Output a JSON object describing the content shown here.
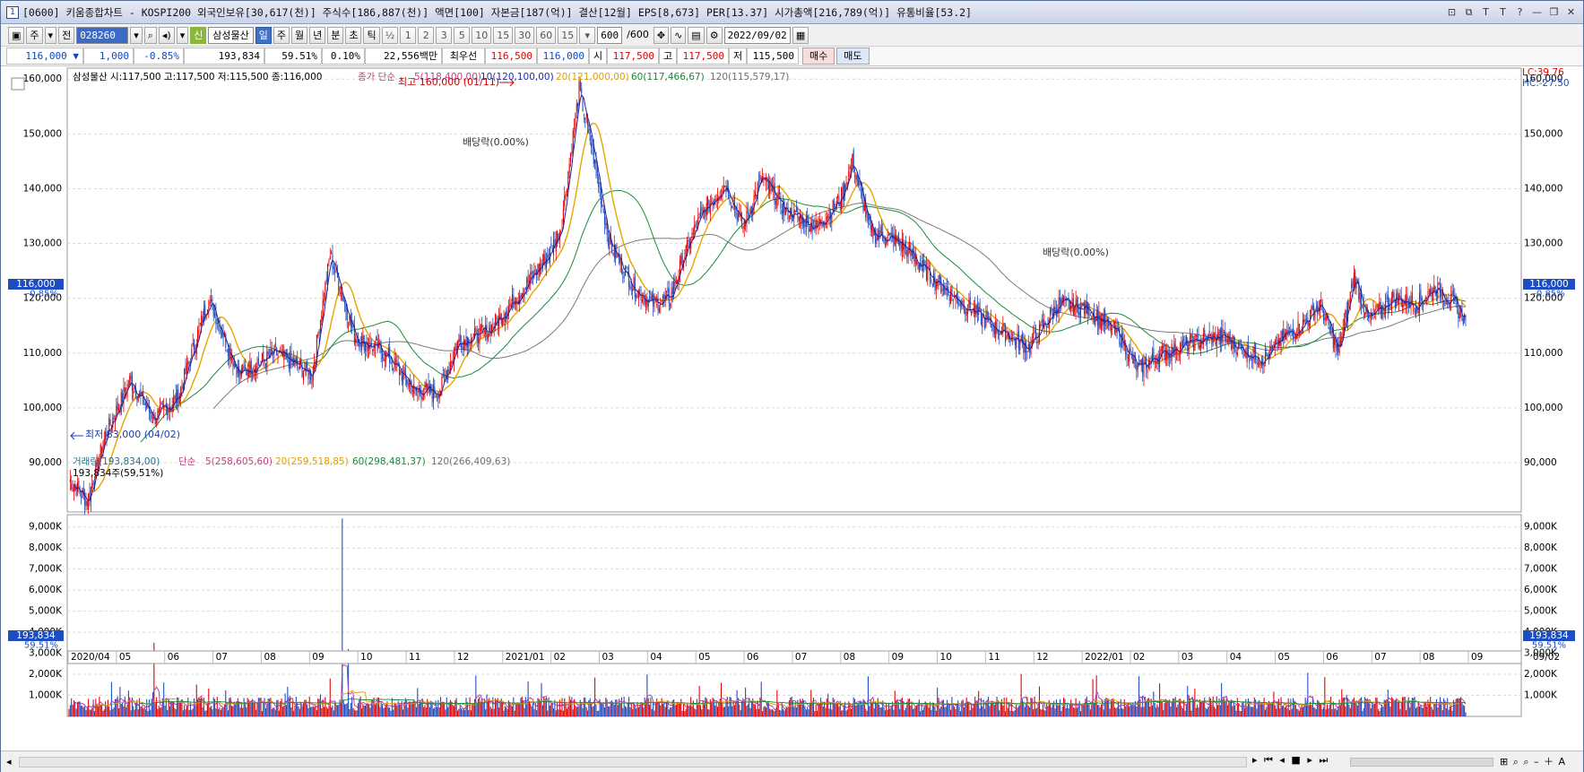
{
  "title": {
    "window_num": "1",
    "text": "[0600] 키움종합차트 - KOSPI200 외국인보유[30,617(천)] 주식수[186,887(천)] 액면[100] 자본금[187(억)] 결산[12월] EPS[8,673] PER[13.37] 시가총액[216,789(억)] 유통비율[53.2]"
  },
  "toolbar": {
    "btn_jong": "주",
    "btn_jeon": "전",
    "code": "028260",
    "stock_badge": "신",
    "stock_name": "삼성물산",
    "periods": [
      "일",
      "주",
      "월",
      "년",
      "분",
      "초",
      "틱"
    ],
    "selected_period": "일",
    "half": "½",
    "minutes": [
      "1",
      "2",
      "3",
      "5",
      "10",
      "15",
      "30",
      "60"
    ],
    "interval": "15",
    "count": "600",
    "count_total": "/600",
    "date": "2022/09/02"
  },
  "quote": {
    "price": "116,000 ▼",
    "change": "1,000",
    "change_pct": "-0.85%",
    "volume": "193,834",
    "vol_ratio": "59.51%",
    "turnover": "0.10%",
    "amount": "22,556백만",
    "priority_label": "최우선",
    "ask": "116,500",
    "bid": "116,000",
    "open_label": "시",
    "open": "117,500",
    "high_label": "고",
    "high": "117,500",
    "low_label": "저",
    "low": "115,500",
    "buy": "매수",
    "sell": "매도"
  },
  "legend": {
    "ohlc": "삼성물산 시:117,500 고:117,500 저:115,500 종:116,000",
    "ma_label": "종가 단순",
    "ma5": "5(118,400,00)",
    "ma10": "10(120,100,00)",
    "ma20": "20(121,000,00)",
    "ma60": "60(117,466,67)",
    "ma120": "120(115,579,17)",
    "lc": "LC:39.76",
    "hc": "HC:-27.50"
  },
  "volume_legend": {
    "label": "거래량(193,834,00)",
    "ma_label": "단순",
    "ma5": "5(258,605,60)",
    "ma20": "20(259,518,85)",
    "ma60": "60(298,481,37)",
    "ma120": "120(266,409,63)",
    "sub": "193,834주(59,51%)"
  },
  "annotations": {
    "high": "최고 160,000 (01/11)",
    "low": "최저 83,000 (04/02)",
    "div1": "배당락(0.00%)",
    "div2": "배당락(0.00%)"
  },
  "markers": {
    "price": "116,000",
    "pct": "-0.85%",
    "vol": "193,834",
    "vol_pct": "59.51%"
  },
  "chart_data": {
    "type": "candlestick",
    "price_axis_ticks": [
      "160,000",
      "150,000",
      "140,000",
      "130,000",
      "120,000",
      "110,000",
      "100,000",
      "90,000"
    ],
    "price_ylim": [
      81000,
      162000
    ],
    "volume_axis_ticks": [
      "9,000K",
      "8,000K",
      "7,000K",
      "6,000K",
      "5,000K",
      "4,000K",
      "3,000K",
      "2,000K",
      "1,000K"
    ],
    "volume_ylim": [
      0,
      9500000
    ],
    "x_labels": [
      "2020/04",
      "05",
      "06",
      "07",
      "08",
      "09",
      "10",
      "11",
      "12",
      "2021/01",
      "02",
      "03",
      "04",
      "05",
      "06",
      "07",
      "08",
      "09",
      "10",
      "11",
      "12",
      "2022/01",
      "02",
      "03",
      "04",
      "05",
      "06",
      "07",
      "08",
      "09"
    ],
    "date_end": "09/02",
    "close_path_keypoints": [
      [
        0,
        87000
      ],
      [
        15,
        83000
      ],
      [
        30,
        95000
      ],
      [
        50,
        105000
      ],
      [
        70,
        98000
      ],
      [
        90,
        102000
      ],
      [
        115,
        120000
      ],
      [
        140,
        106000
      ],
      [
        170,
        110000
      ],
      [
        200,
        106000
      ],
      [
        215,
        128000
      ],
      [
        235,
        113000
      ],
      [
        260,
        110000
      ],
      [
        285,
        103000
      ],
      [
        305,
        103000
      ],
      [
        320,
        112000
      ],
      [
        345,
        114000
      ],
      [
        375,
        122000
      ],
      [
        395,
        128000
      ],
      [
        405,
        133000
      ],
      [
        420,
        158000
      ],
      [
        430,
        148000
      ],
      [
        445,
        130000
      ],
      [
        465,
        122000
      ],
      [
        480,
        119000
      ],
      [
        495,
        120000
      ],
      [
        505,
        127000
      ],
      [
        520,
        135000
      ],
      [
        540,
        141000
      ],
      [
        555,
        133000
      ],
      [
        570,
        142000
      ],
      [
        590,
        136000
      ],
      [
        615,
        133000
      ],
      [
        635,
        138000
      ],
      [
        645,
        145000
      ],
      [
        660,
        132000
      ],
      [
        685,
        130000
      ],
      [
        705,
        125000
      ],
      [
        730,
        120000
      ],
      [
        760,
        115000
      ],
      [
        790,
        111000
      ],
      [
        815,
        119000
      ],
      [
        840,
        118000
      ],
      [
        865,
        113000
      ],
      [
        880,
        107000
      ],
      [
        900,
        110000
      ],
      [
        925,
        112000
      ],
      [
        950,
        113000
      ],
      [
        970,
        110000
      ],
      [
        985,
        109000
      ],
      [
        1000,
        113000
      ],
      [
        1015,
        115000
      ],
      [
        1030,
        119000
      ],
      [
        1045,
        110000
      ],
      [
        1058,
        124000
      ],
      [
        1070,
        116000
      ],
      [
        1090,
        120000
      ],
      [
        1110,
        119000
      ],
      [
        1125,
        122000
      ],
      [
        1140,
        119000
      ],
      [
        1150,
        116000
      ]
    ],
    "ma5_last": 118400,
    "ma10_last": 120100,
    "ma20_last": 121000,
    "ma60_last": 117466.67,
    "ma120_last": 115579.17,
    "volume_last": 193834,
    "volume_peaks": [
      [
        225,
        9400000
      ],
      [
        230,
        3200000
      ],
      [
        215,
        1800000
      ],
      [
        70,
        3500000
      ],
      [
        225,
        3200000
      ]
    ]
  }
}
